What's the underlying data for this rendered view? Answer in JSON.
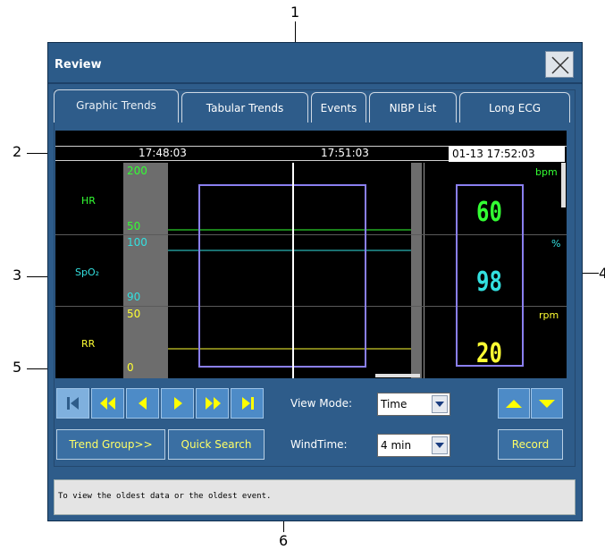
{
  "window": {
    "title": "Review"
  },
  "tabs": [
    {
      "label": "Graphic Trends",
      "active": true
    },
    {
      "label": "Tabular Trends",
      "active": false
    },
    {
      "label": "Events",
      "active": false
    },
    {
      "label": "NIBP List",
      "active": false
    },
    {
      "label": "Long ECG",
      "active": false
    }
  ],
  "timebar": {
    "start": "17:48:03",
    "middle": "17:51:03",
    "current": "01-13 17:52:03"
  },
  "params": [
    {
      "name": "HR",
      "color": "#33ff33",
      "scale_top": "200",
      "scale_bottom": "50",
      "unit": "bpm",
      "value": "60"
    },
    {
      "name": "SpO₂",
      "color": "#33e0e0",
      "scale_top": "100",
      "scale_bottom": "90",
      "unit": "%",
      "value": "98"
    },
    {
      "name": "RR",
      "color": "#ffff33",
      "scale_top": "50",
      "scale_bottom": "0",
      "unit": "rpm",
      "value": "20"
    }
  ],
  "controls": {
    "nav_icons": [
      "first-icon",
      "fast-back-icon",
      "back-icon",
      "forward-icon",
      "fast-forward-icon",
      "last-icon"
    ],
    "view_mode_label": "View Mode:",
    "view_mode_value": "Time",
    "wind_time_label": "WindTime:",
    "wind_time_value": "4 min",
    "trend_group": "Trend Group>>",
    "quick_search": "Quick Search",
    "record": "Record",
    "up_icon": "up-arrow-icon",
    "down_icon": "down-arrow-icon"
  },
  "status": {
    "message": "To view the oldest data or the oldest event."
  },
  "callouts": [
    "1",
    "2",
    "3",
    "4",
    "5",
    "6"
  ],
  "colors": {
    "panel": "#2e5c8a",
    "button": "#4d8bc7",
    "cursor_box": "#8a7ff0",
    "nav_glyph": "#ffff00"
  }
}
